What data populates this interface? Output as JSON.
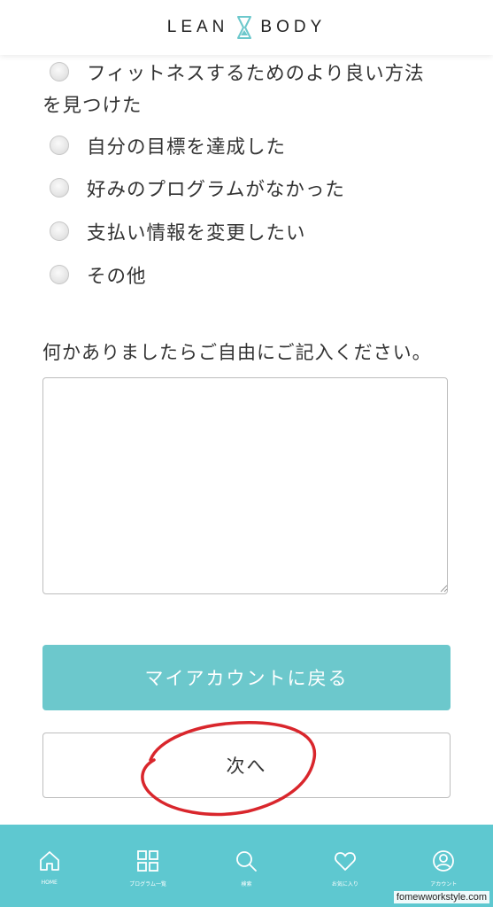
{
  "header": {
    "logo_left": "LEAN",
    "logo_right": "BODY"
  },
  "options": [
    {
      "label_line1": "フィットネスするためのより良い方法",
      "label_line2": "を見つけた"
    },
    {
      "label": "自分の目標を達成した"
    },
    {
      "label": "好みのプログラムがなかった"
    },
    {
      "label": "支払い情報を変更したい"
    },
    {
      "label": "その他"
    }
  ],
  "free_text": {
    "label": "何かありましたらご自由にご記入ください。",
    "value": ""
  },
  "buttons": {
    "back": "マイアカウントに戻る",
    "next": "次へ"
  },
  "bottom_nav": [
    {
      "label": "HOME",
      "icon": "home-icon"
    },
    {
      "label": "プログラム一覧",
      "icon": "grid-icon"
    },
    {
      "label": "検索",
      "icon": "search-icon"
    },
    {
      "label": "お気に入り",
      "icon": "heart-icon"
    },
    {
      "label": "アカウント",
      "icon": "user-icon"
    }
  ],
  "watermark": "fomewworkstyle.com",
  "colors": {
    "accent": "#6cc8cc",
    "nav_bg": "#5ec8d0",
    "annotation": "#d9262c",
    "logo_mark": "#6cc8cc"
  }
}
